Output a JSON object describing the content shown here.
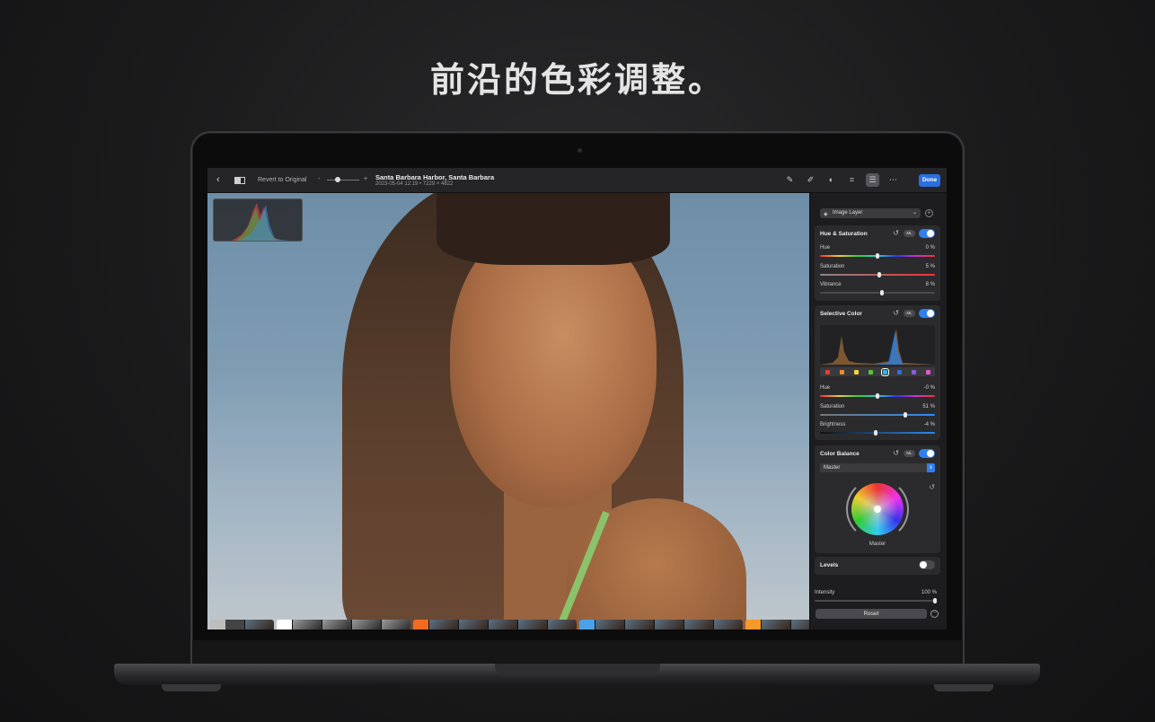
{
  "headline": "前沿的色彩调整。",
  "toolbar": {
    "back_icon": "chevron-left-icon",
    "revert_label": "Revert to Original",
    "zoom_minus": "-",
    "zoom_plus": "+",
    "title": "Santa Barbara Harbor, Santa Barbara",
    "subtitle": "2023-05-04 12:19 • 7229 × 4822",
    "done_label": "Done",
    "tool_icons": [
      "annotate-icon",
      "retouch-brush-icon",
      "effects-icon",
      "crop-icon",
      "adjust-sliders-icon",
      "more-menu-icon"
    ]
  },
  "filmstrip": {
    "groups": [
      {
        "tag": "C",
        "color": "#bdbdbd",
        "text_color": "#333",
        "thumbs": 1,
        "plus": "+"
      },
      {
        "tag": "BW",
        "color": "#ffffff",
        "text_color": "#222",
        "thumbs": 4
      },
      {
        "tag": "CN",
        "color": "#f26b21",
        "text_color": "#fff",
        "thumbs": 5
      },
      {
        "tag": "CF",
        "color": "#4aa3e8",
        "text_color": "#fff",
        "thumbs": 5
      },
      {
        "tag": "MF",
        "color": "#f39a2a",
        "text_color": "#fff",
        "thumbs": 2
      }
    ]
  },
  "panel": {
    "layer_select": "Image Layer",
    "hue_saturation": {
      "title": "Hue & Saturation",
      "ml": "ML",
      "enabled": true,
      "sliders": [
        {
          "label": "Hue",
          "value": "0 %",
          "pos": 0.5
        },
        {
          "label": "Saturation",
          "value": "5 %",
          "pos": 0.52
        },
        {
          "label": "Vibrance",
          "value": "8 %",
          "pos": 0.54
        }
      ]
    },
    "selective_color": {
      "title": "Selective Color",
      "ml": "ML",
      "enabled": true,
      "swatches": [
        "#e83a3a",
        "#f08a2a",
        "#f2d93a",
        "#5cc23a",
        "#2db5e0",
        "#2d6fe0",
        "#8a5ae0",
        "#e05ad0"
      ],
      "selected_swatch": 4,
      "sliders": [
        {
          "label": "Hue",
          "value": "-0 %",
          "pos": 0.5
        },
        {
          "label": "Saturation",
          "value": "51 %",
          "pos": 0.75
        },
        {
          "label": "Brightness",
          "value": "-4 %",
          "pos": 0.48
        }
      ]
    },
    "color_balance": {
      "title": "Color Balance",
      "ml": "ML",
      "enabled": true,
      "mode": "Master",
      "wheel_label": "Master"
    },
    "levels": {
      "title": "Levels",
      "enabled": false
    },
    "intensity": {
      "label": "Intensity",
      "value": "100 %",
      "pos": 1.0
    },
    "reset_label": "Reset"
  }
}
